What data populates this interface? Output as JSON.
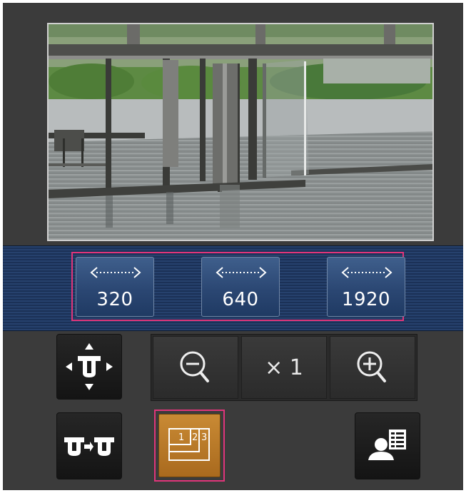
{
  "resolutions": [
    {
      "label": "320"
    },
    {
      "label": "640"
    },
    {
      "label": "1920"
    }
  ],
  "zoom": {
    "level_label": "× 1"
  },
  "layout_button": {
    "pane_numbers": [
      "1",
      "2",
      "3"
    ]
  },
  "colors": {
    "background": "#3b3b3b",
    "strip": "#26416d",
    "highlight": "#e0357a",
    "layout_active": "#b87a2a"
  },
  "icons": {
    "pan_tilt": "pan-tilt-control-icon",
    "camera_switch": "camera-switch-icon",
    "zoom_out": "zoom-out-icon",
    "zoom_in": "zoom-in-icon",
    "multi_screen": "multi-screen-layout-icon",
    "user_list": "user-list-icon",
    "resolution_arrow": "left-right-arrow-icon"
  }
}
